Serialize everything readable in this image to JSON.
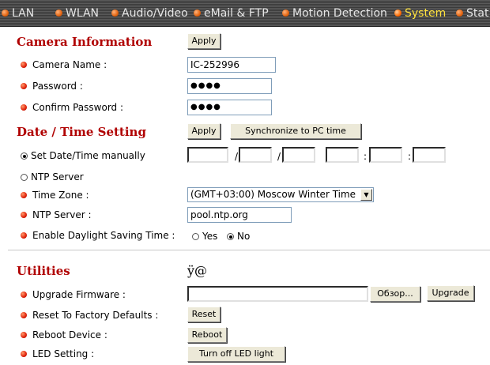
{
  "nav": {
    "tabs": [
      {
        "label": "LAN"
      },
      {
        "label": "WLAN"
      },
      {
        "label": "Audio/Video"
      },
      {
        "label": "eMail & FTP"
      },
      {
        "label": "Motion Detection"
      },
      {
        "label": "System"
      },
      {
        "label": "Stat"
      }
    ],
    "active": "System"
  },
  "camera_info": {
    "title": "Camera Information",
    "apply_label": "Apply",
    "camera_name_label": "Camera Name :",
    "camera_name_value": "IC-252996",
    "password_label": "Password :",
    "password_value": "●●●●",
    "confirm_label": "Confirm Password :",
    "confirm_value": "●●●●"
  },
  "datetime": {
    "title": "Date / Time Setting",
    "apply_label": "Apply",
    "sync_label": "Synchronize to PC time",
    "manual_label": "Set Date/Time manually",
    "ntp_radio_label": "NTP Server",
    "date_sep": "/",
    "time_sep": ":",
    "timezone_label": "Time Zone :",
    "timezone_value": "(GMT+03:00) Moscow Winter Time",
    "ntp_server_label": "NTP Server :",
    "ntp_server_value": "pool.ntp.org",
    "dst_label": "Enable Daylight Saving Time :",
    "dst_yes": "Yes",
    "dst_no": "No"
  },
  "utilities": {
    "title": "Utilities",
    "garbled_text": "ÿ@",
    "upgrade_label": "Upgrade Firmware :",
    "browse_label": "Обзор...",
    "upgrade_button": "Upgrade",
    "reset_label": "Reset To Factory Defaults :",
    "reset_button": "Reset",
    "reboot_label": "Reboot Device :",
    "reboot_button": "Reboot",
    "led_label": "LED Setting :",
    "led_button": "Turn off LED light"
  }
}
